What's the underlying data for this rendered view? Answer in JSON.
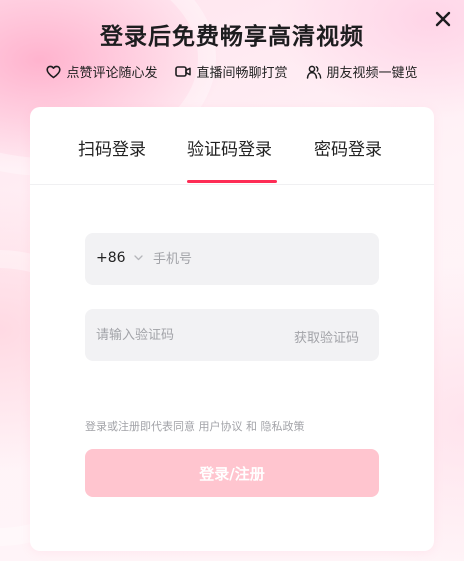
{
  "header": {
    "title": "登录后免费畅享高清视频",
    "close_icon": "close-icon"
  },
  "features": [
    {
      "icon": "heart-icon",
      "label": "点赞评论随心发"
    },
    {
      "icon": "video-camera-icon",
      "label": "直播间畅聊打赏"
    },
    {
      "icon": "friends-icon",
      "label": "朋友视频一键览"
    }
  ],
  "tabs": {
    "items": [
      {
        "label": "扫码登录"
      },
      {
        "label": "验证码登录"
      },
      {
        "label": "密码登录"
      }
    ],
    "active": "验证码登录"
  },
  "form": {
    "country_code": "+86",
    "phone_placeholder": "手机号",
    "code_placeholder": "请输入验证码",
    "get_code_label": "获取验证码"
  },
  "agreement": {
    "prefix": "登录或注册即代表同意",
    "user_agreement": "用户协议",
    "and": "和",
    "privacy_policy": "隐私政策"
  },
  "submit_label": "登录/注册",
  "colors": {
    "accent": "#fe2c55",
    "submit_disabled": "#ffc5cf",
    "field_bg": "#f2f2f4",
    "placeholder": "#a2a3a8"
  }
}
